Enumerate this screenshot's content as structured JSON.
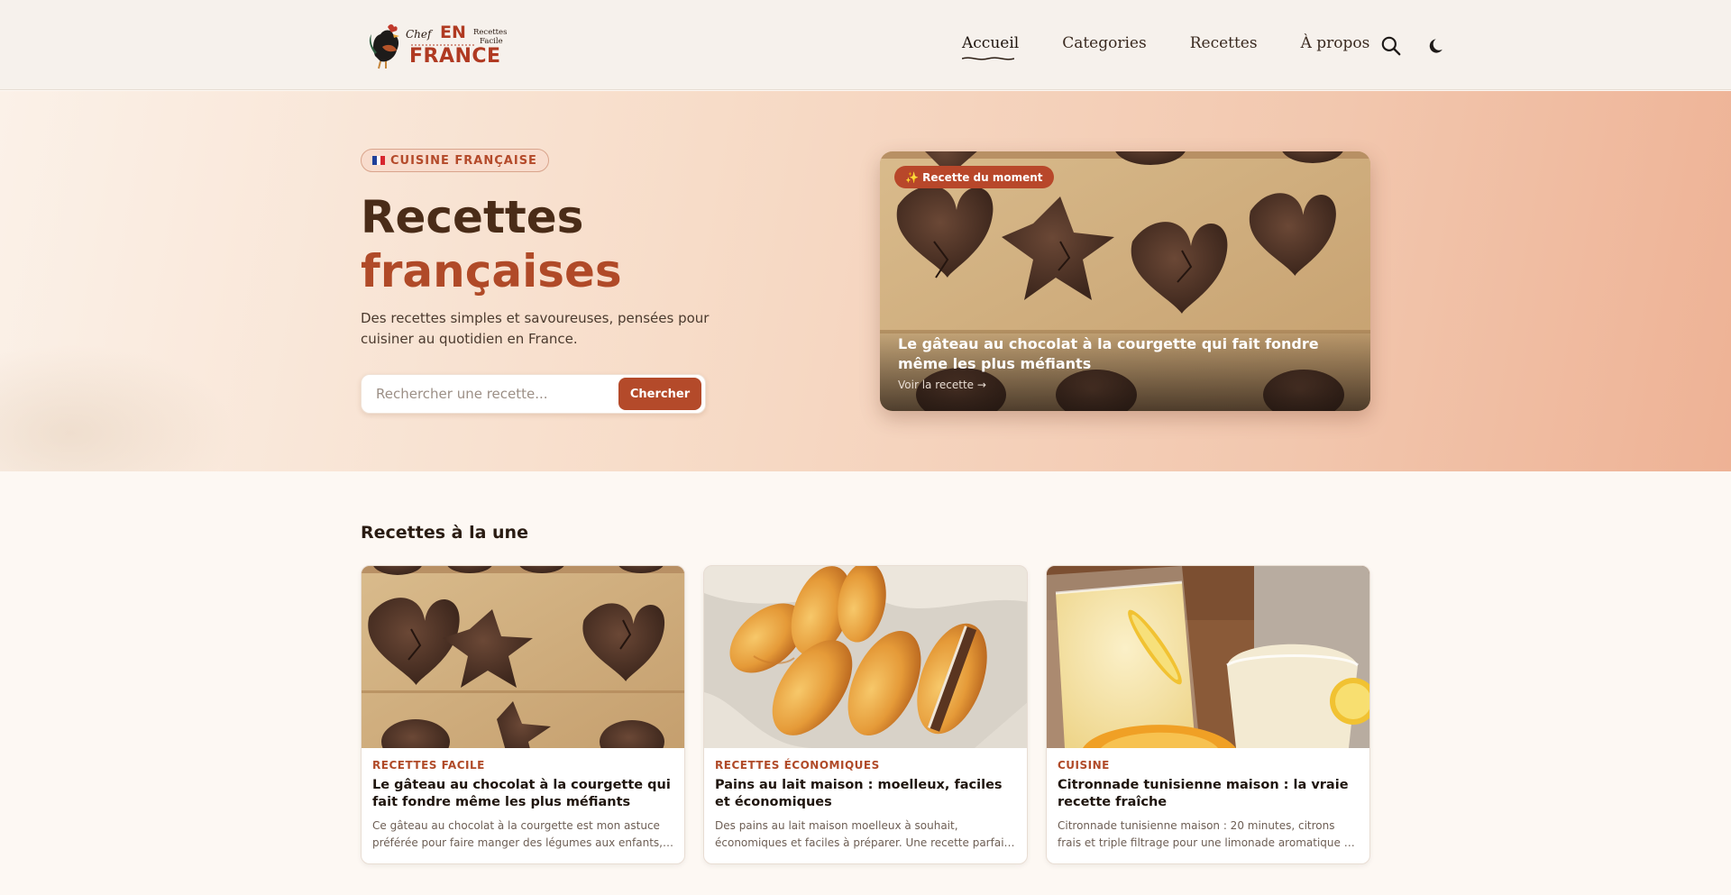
{
  "header": {
    "logo": {
      "text_en": "EN",
      "text_chef": "Chef",
      "text_france": "FRANCE",
      "text_recettes": "Recettes",
      "text_facile": "Facile"
    },
    "nav": [
      {
        "label": "Accueil",
        "active": true
      },
      {
        "label": "Categories",
        "active": false
      },
      {
        "label": "Recettes",
        "active": false
      },
      {
        "label": "À propos",
        "active": false
      }
    ],
    "icons": [
      "search-icon",
      "moon-icon"
    ]
  },
  "hero": {
    "badge": "CUISINE FRANÇAISE",
    "title_line1": "Recettes",
    "title_line2": "françaises",
    "description": "Des recettes simples et savoureuses, pensées pour cuisiner au quotidien en France.",
    "search": {
      "placeholder": "Rechercher une recette...",
      "button": "Chercher"
    },
    "featured": {
      "tag": "✨ Recette du moment",
      "title": "Le gâteau au chocolat à la courgette qui fait fondre même les plus méfiants",
      "link": "Voir la recette →"
    }
  },
  "section": {
    "title": "Recettes à la une",
    "cards": [
      {
        "category": "RECETTES FACILE",
        "title": "Le gâteau au chocolat à la courgette qui fait fondre même les plus méfiants",
        "description": "Ce gâteau au chocolat à la courgette est mon astuce préférée pour faire manger des légumes aux enfants, sans qu'ils s'en rendent compte.",
        "image": "chocolate-cakes"
      },
      {
        "category": "RECETTES ÉCONOMIQUES",
        "title": "Pains au lait maison : moelleux, faciles et économiques",
        "description": "Des pains au lait maison moelleux à souhait, économiques et faciles à préparer. Une recette parfaite pour le goûter.",
        "image": "milk-breads"
      },
      {
        "category": "CUISINE",
        "title": "Citronnade tunisienne maison : la vraie recette fraîche",
        "description": "Citronnade tunisienne maison : 20 minutes, citrons frais et triple filtrage pour une limonade aromatique et onctueuse.",
        "image": "lemonade"
      }
    ]
  },
  "colors": {
    "accent": "#b44a2a",
    "title_dark": "#4a2c18",
    "title_accent": "#b04a28",
    "page_bg": "#fdf8f3"
  }
}
